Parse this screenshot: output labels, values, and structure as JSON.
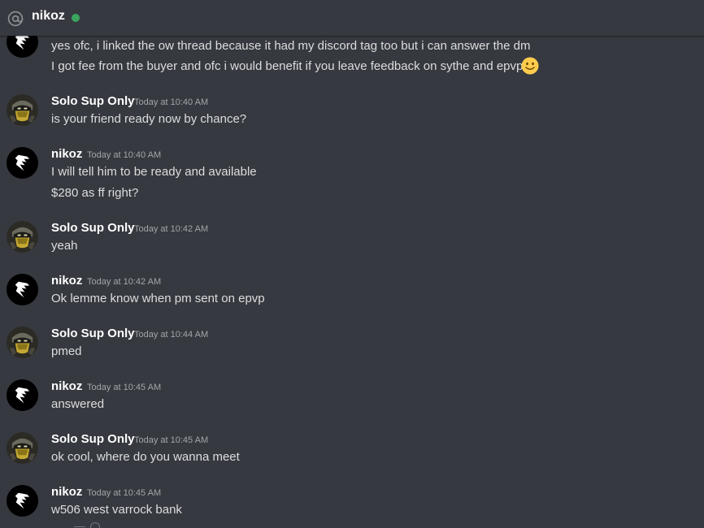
{
  "header": {
    "title": "nikoz",
    "status_color": "#3ba55d",
    "at_icon": "at-sign-icon"
  },
  "messages": {
    "continued": {
      "lines": [
        "yes ofc, i linked the ow thread because it had my discord tag too but i can answer the dm",
        "I got fee from the buyer and ofc i would benefit if you leave feedback on sythe and epvp"
      ],
      "emoji": "slightly-smiling-face-icon"
    },
    "groups": [
      {
        "author": "Solo Sup Only",
        "time": "Today at 10:40 AM",
        "lines": [
          "is your friend ready now by chance?"
        ]
      },
      {
        "author": "nikoz",
        "time": "Today at 10:40 AM",
        "lines": [
          "I will tell him to be ready and available",
          "$280 as ff right?"
        ]
      },
      {
        "author": "Solo Sup Only",
        "time": "Today at 10:42 AM",
        "lines": [
          "yeah"
        ]
      },
      {
        "author": "nikoz",
        "time": "Today at 10:42 AM",
        "lines": [
          "Ok lemme know when pm sent on epvp"
        ]
      },
      {
        "author": "Solo Sup Only",
        "time": "Today at 10:44 AM",
        "lines": [
          "pmed"
        ]
      },
      {
        "author": "nikoz",
        "time": "Today at 10:45 AM",
        "lines": [
          "answered"
        ]
      },
      {
        "author": "Solo Sup Only",
        "time": "Today at 10:45 AM",
        "lines": [
          "ok cool, where do you wanna meet"
        ]
      },
      {
        "author": "nikoz",
        "time": "Today at 10:45 AM",
        "lines": [
          "w506 west varrock bank"
        ]
      }
    ]
  }
}
